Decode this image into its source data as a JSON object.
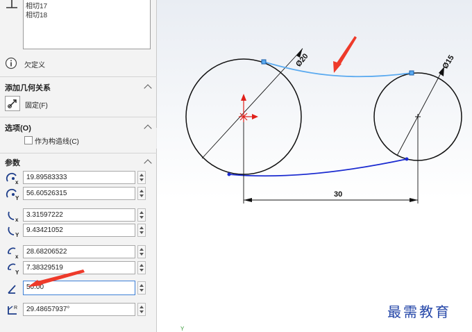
{
  "relations_list": {
    "items": [
      "相切17",
      "相切18"
    ]
  },
  "status": {
    "label": "欠定义"
  },
  "add_relations": {
    "title": "添加几何关系",
    "fix_label": "固定(F)"
  },
  "options": {
    "title": "选项(O)",
    "construction_label": "作为构造线(C)"
  },
  "parameters": {
    "title": "参数",
    "fields": [
      "19.89583333",
      "56.60526315",
      "3.31597222",
      "9.43421052",
      "28.68206522",
      "7.38329519",
      "50.00",
      "29.48657937°"
    ]
  },
  "drawing": {
    "left_circle_dim": "Ø20",
    "right_circle_dim": "Ø15",
    "distance_dim": "30",
    "colors": {
      "selected_spline": "#5aaaf0",
      "spline": "#1a2ad0",
      "annotation_arrow": "#ee3a2a",
      "origin": "#e0201a"
    }
  },
  "overlay": {
    "axis_label": "Y",
    "watermark": "最需教育"
  }
}
